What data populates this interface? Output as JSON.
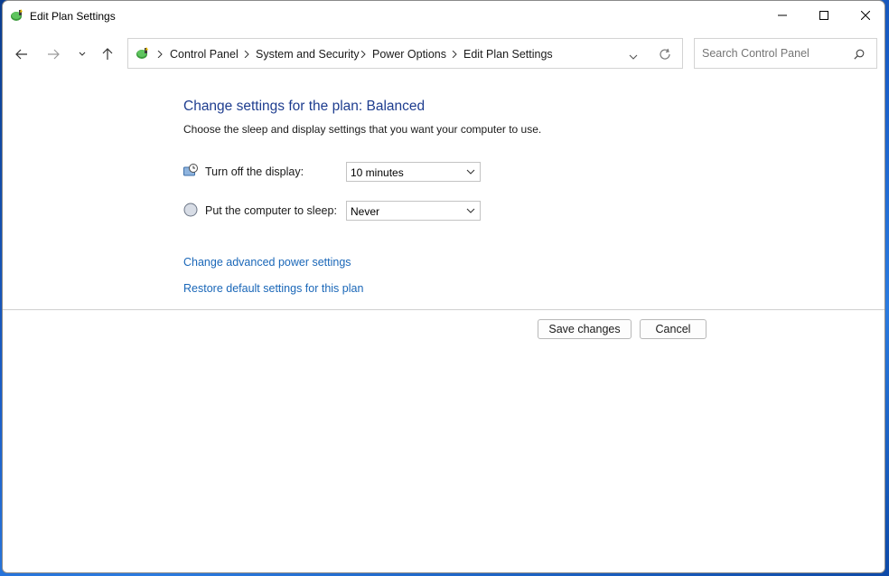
{
  "window": {
    "title": "Edit Plan Settings",
    "controls": {
      "minimize": "minimize-icon",
      "maximize": "maximize-icon",
      "close": "close-icon"
    }
  },
  "navigation": {
    "back_icon": "arrow-left-icon",
    "forward_icon": "arrow-right-icon",
    "recent_icon": "chevron-down-icon",
    "up_icon": "arrow-up-icon"
  },
  "address_bar": {
    "breadcrumbs": [
      "Control Panel",
      "System and Security",
      "Power Options",
      "Edit Plan Settings"
    ],
    "refresh_icon": "refresh-icon"
  },
  "search": {
    "placeholder": "Search Control Panel",
    "icon": "search-icon"
  },
  "content": {
    "heading": "Change settings for the plan: Balanced",
    "subtext": "Choose the sleep and display settings that you want your computer to use.",
    "settings": [
      {
        "label": "Turn off the display:",
        "value": "10 minutes",
        "icon": "display-clock-icon"
      },
      {
        "label": "Put the computer to sleep:",
        "value": "Never",
        "icon": "moon-sleep-icon"
      }
    ],
    "links": [
      "Change advanced power settings",
      "Restore default settings for this plan"
    ]
  },
  "buttons": {
    "save": "Save changes",
    "cancel": "Cancel"
  },
  "colors": {
    "heading": "#1e3d8f",
    "link": "#1a67b8",
    "desktop": "#1a5fc9"
  }
}
